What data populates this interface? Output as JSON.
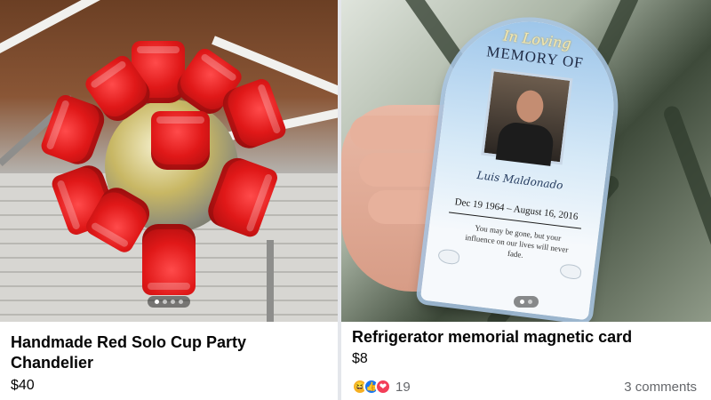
{
  "listings": [
    {
      "title": "Handmade Red Solo Cup Party Chandelier",
      "price": "$40",
      "photo_icon": "red-cup-chandelier-photo",
      "carousel": {
        "count": 4,
        "active": 1
      }
    },
    {
      "title": "Refrigerator memorial magnetic card",
      "price": "$8",
      "photo_icon": "memorial-card-photo",
      "carousel": {
        "count": 2,
        "active": 1
      },
      "card_text": {
        "script": "In Loving",
        "heading": "MEMORY OF",
        "name": "Luis Maldonado",
        "dates": "Dec 19 1964 – August 16, 2016",
        "verse": "You may be gone, but your influence on our lives will never fade."
      },
      "reactions": {
        "icons": [
          "haha-reaction-icon",
          "like-reaction-icon",
          "love-reaction-icon"
        ],
        "count": "19"
      },
      "comments": "3 comments"
    }
  ],
  "colors": {
    "text_primary": "#050505",
    "text_secondary": "#65676b",
    "cup_red": "#e01818",
    "like_blue": "#1877f2",
    "love_red": "#f33e58",
    "haha_yellow": "#f7b125"
  }
}
